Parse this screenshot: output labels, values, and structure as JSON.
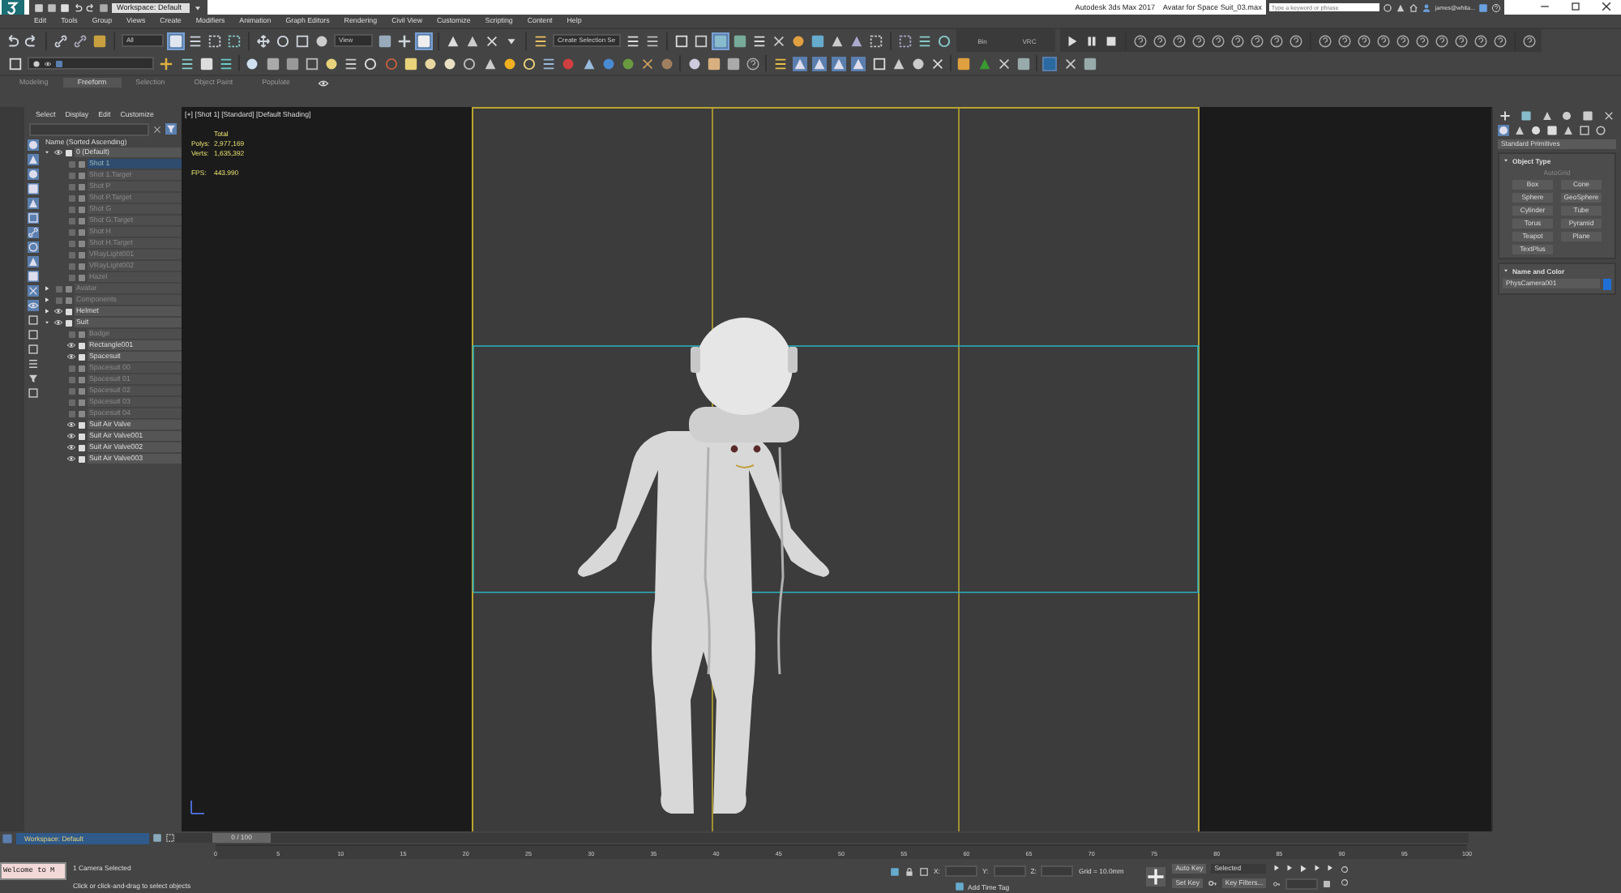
{
  "title_bar": {
    "workspace": "Workspace: Default",
    "title": "Autodesk 3ds Max 2017",
    "file": "Avatar for Space Suit_03.max",
    "search": {
      "placeholder": "Type a keyword or phrase"
    },
    "user": "james@whita..."
  },
  "menu": [
    "Edit",
    "Tools",
    "Group",
    "Views",
    "Create",
    "Modifiers",
    "Animation",
    "Graph Editors",
    "Rendering",
    "Civil View",
    "Customize",
    "Scripting",
    "Content",
    "Help"
  ],
  "main_toolbar": {
    "selection_filter": "All",
    "reference_coord": "View",
    "named_selection": "Create Selection Se",
    "labels": [
      "Bin",
      "VRC"
    ]
  },
  "ribbon_tabs": [
    {
      "label": "Modeling",
      "selected": false
    },
    {
      "label": "Freeform",
      "selected": true
    },
    {
      "label": "Selection",
      "selected": false
    },
    {
      "label": "Object Paint",
      "selected": false
    },
    {
      "label": "Populate",
      "selected": false
    }
  ],
  "scene_explorer": {
    "tabs": [
      "Select",
      "Display",
      "Edit",
      "Customize"
    ],
    "column": "Name (Sorted Ascending)",
    "tree": [
      {
        "name": "0 (Default)",
        "expanded": true,
        "hidden": false,
        "selected": false,
        "children": [
          {
            "name": "Shot 1",
            "hidden": true,
            "selected": true
          },
          {
            "name": "Shot 1.Target",
            "hidden": true,
            "selected": false
          },
          {
            "name": "Shot P",
            "hidden": true,
            "selected": false
          },
          {
            "name": "Shot P.Target",
            "hidden": true,
            "selected": false
          },
          {
            "name": "Shot G",
            "hidden": true,
            "selected": false
          },
          {
            "name": "Shot G.Target",
            "hidden": true,
            "selected": false
          },
          {
            "name": "Shot H",
            "hidden": true,
            "selected": false
          },
          {
            "name": "Shot H.Target",
            "hidden": true,
            "selected": false
          },
          {
            "name": "VRayLight001",
            "hidden": true,
            "selected": false
          },
          {
            "name": "VRayLight002",
            "hidden": true,
            "selected": false
          },
          {
            "name": "Hazel",
            "hidden": true,
            "selected": false
          }
        ]
      },
      {
        "name": "Avatar",
        "expanded": false,
        "hidden": true,
        "selected": false
      },
      {
        "name": "Components",
        "expanded": false,
        "hidden": true,
        "selected": false
      },
      {
        "name": "Helmet",
        "expanded": false,
        "hidden": false,
        "selected": false
      },
      {
        "name": "Suit",
        "expanded": true,
        "hidden": false,
        "selected": false,
        "children": [
          {
            "name": "Badge",
            "hidden": true,
            "selected": false
          },
          {
            "name": "Rectangle001",
            "hidden": false,
            "selected": false
          },
          {
            "name": "Spacesuit",
            "hidden": false,
            "selected": false
          },
          {
            "name": "Spacesuit 00",
            "hidden": true,
            "selected": false
          },
          {
            "name": "Spacesuit 01",
            "hidden": true,
            "selected": false
          },
          {
            "name": "Spacesuit 02",
            "hidden": true,
            "selected": false
          },
          {
            "name": "Spacesuit 03",
            "hidden": true,
            "selected": false
          },
          {
            "name": "Spacesuit 04",
            "hidden": true,
            "selected": false
          },
          {
            "name": "Suit Air Valve",
            "hidden": false,
            "selected": false
          },
          {
            "name": "Suit Air Valve001",
            "hidden": false,
            "selected": false
          },
          {
            "name": "Suit Air Valve002",
            "hidden": false,
            "selected": false
          },
          {
            "name": "Suit Air Valve003",
            "hidden": false,
            "selected": false
          }
        ]
      }
    ]
  },
  "viewport": {
    "label": "[+] [Shot 1] [Standard] [Default Shading]",
    "stats_heading": "Total",
    "stats": [
      {
        "label": "Polys:",
        "value": "2,977,169"
      },
      {
        "label": "Verts:",
        "value": "1,635,392"
      }
    ],
    "fps_label": "FPS:",
    "fps": "443.990"
  },
  "command_panel": {
    "category": "Standard Primitives",
    "object_type": {
      "title": "Object Type",
      "autogrid": {
        "label": "AutoGrid",
        "disabled": true
      },
      "buttons": [
        "Box",
        "Cone",
        "Sphere",
        "GeoSphere",
        "Cylinder",
        "Tube",
        "Torus",
        "Pyramid",
        "Teapot",
        "Plane",
        "TextPlus"
      ]
    },
    "name_color": {
      "title": "Name and Color",
      "name": "PhysCamera001",
      "color": "#1f6fd6"
    }
  },
  "time_slider": {
    "position": "0 / 100",
    "ticks": [
      "0",
      "5",
      "10",
      "15",
      "20",
      "25",
      "30",
      "35",
      "40",
      "45",
      "50",
      "55",
      "60",
      "65",
      "70",
      "75",
      "80",
      "85",
      "90",
      "95",
      "100"
    ]
  },
  "status_bar": {
    "workspace": "Workspace: Default",
    "listener": "Welcome to M",
    "prompt": "1 Camera Selected",
    "hint": "Click or click-and-drag to select objects",
    "coords": [
      "X:",
      "Y:",
      "Z:"
    ],
    "grid": "Grid = 10.0mm",
    "add_time_tag": "Add Time Tag",
    "auto_key": "Auto Key",
    "key_mode": "Selected",
    "set_key": "Set Key",
    "key_filters": "Key Filters..."
  }
}
